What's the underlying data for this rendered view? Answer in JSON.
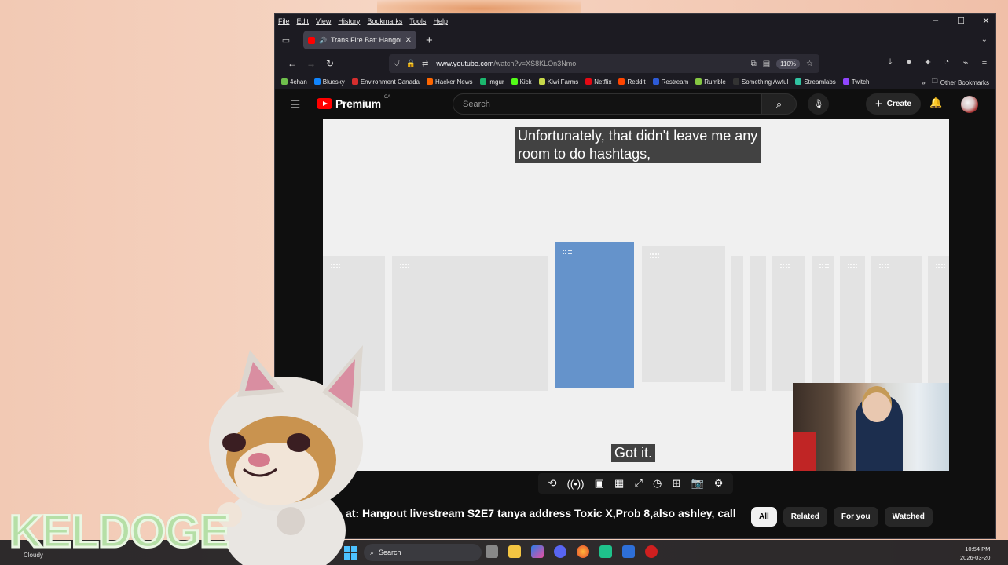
{
  "browser": {
    "menus": [
      "File",
      "Edit",
      "View",
      "History",
      "Bookmarks",
      "Tools",
      "Help"
    ],
    "window_controls": [
      "–",
      "☐",
      "✕"
    ],
    "tab": {
      "title": "Trans Fire Bat: Hangout live",
      "close": "✕"
    },
    "new_tab": "+",
    "url": {
      "host": "www.youtube.com",
      "path": "/watch?v=XS8KLOn3Nmo",
      "zoom": "110%"
    },
    "bookmarks": [
      {
        "label": "4chan",
        "color": "#6fbf4c"
      },
      {
        "label": "Bluesky",
        "color": "#1185fe"
      },
      {
        "label": "Environment Canada",
        "color": "#d62e2e"
      },
      {
        "label": "Hacker News",
        "color": "#ff6600"
      },
      {
        "label": "imgur",
        "color": "#1bb76e"
      },
      {
        "label": "Kick",
        "color": "#53fc18"
      },
      {
        "label": "Kiwi Farms",
        "color": "#c7d84a"
      },
      {
        "label": "Netflix",
        "color": "#e50914"
      },
      {
        "label": "Reddit",
        "color": "#ff4500"
      },
      {
        "label": "Restream",
        "color": "#2d5bd8"
      },
      {
        "label": "Rumble",
        "color": "#85c742"
      },
      {
        "label": "Something Awful",
        "color": "#333333"
      },
      {
        "label": "Streamlabs",
        "color": "#31c3a2"
      },
      {
        "label": "Twitch",
        "color": "#9146ff"
      }
    ],
    "bookmarks_overflow": "»",
    "other_bookmarks": "Other Bookmarks"
  },
  "youtube": {
    "brand": "Premium",
    "country": "CA",
    "search_placeholder": "Search",
    "create_label": "Create",
    "caption_lines": [
      "Unfortunately, that didn't leave me any",
      "room to do hashtags,"
    ],
    "got_it": "Got it.",
    "video_title": "at: Hangout livestream S2E7 tanya address Toxic X,Prob 8,also ashley, call",
    "chips": [
      {
        "label": "All",
        "active": true
      },
      {
        "label": "Related",
        "active": false
      },
      {
        "label": "For you",
        "active": false
      },
      {
        "label": "Watched",
        "active": false
      }
    ],
    "control_icons": [
      "repeat-icon",
      "broadcast-icon",
      "cast-icon",
      "clapper-icon",
      "resize-icon",
      "speed-icon",
      "add-screen-icon",
      "camera-icon",
      "settings-icon"
    ]
  },
  "taskbar": {
    "weather": "Cloudy",
    "search": "Search",
    "time": "10:54 PM",
    "date": "2026-03-20"
  },
  "overlay": {
    "streamer_name": "KELDOGE"
  },
  "colors": {
    "youtube_red": "#ff0000",
    "chip_active_bg": "#f1f1f1",
    "highlighted_card": "#6593cb"
  }
}
